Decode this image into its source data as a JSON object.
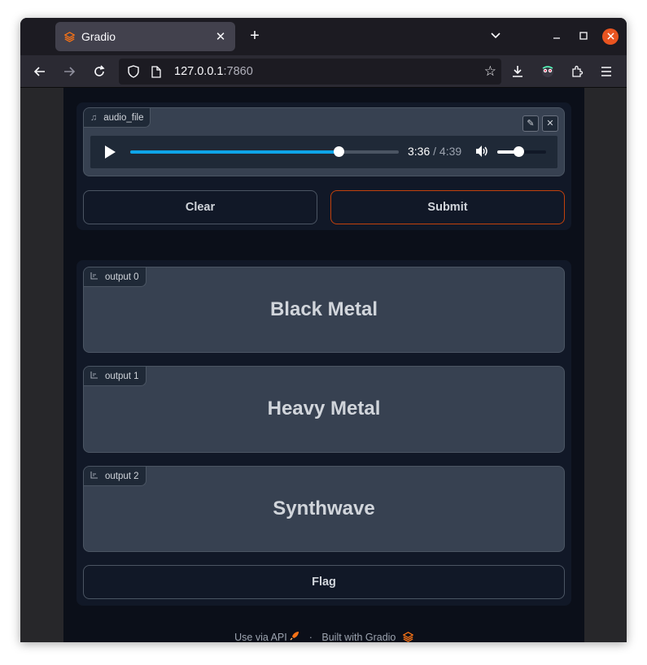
{
  "browser": {
    "tab_title": "Gradio",
    "url_host": "127.0.0.1",
    "url_port": ":7860"
  },
  "audio": {
    "label": "audio_file",
    "current_time": "3:36",
    "separator": "/",
    "duration": "4:39",
    "progress": 0.775,
    "volume": 0.43
  },
  "buttons": {
    "clear": "Clear",
    "submit": "Submit",
    "flag": "Flag"
  },
  "outputs": [
    {
      "label": "output 0",
      "value": "Black Metal"
    },
    {
      "label": "output 1",
      "value": "Heavy Metal"
    },
    {
      "label": "output 2",
      "value": "Synthwave"
    }
  ],
  "footer": {
    "api": "Use via API",
    "dot": "·",
    "built": "Built with Gradio"
  },
  "colors": {
    "accent": "#0ea5e9",
    "brand": "#f97316",
    "window_close": "#e95420"
  }
}
